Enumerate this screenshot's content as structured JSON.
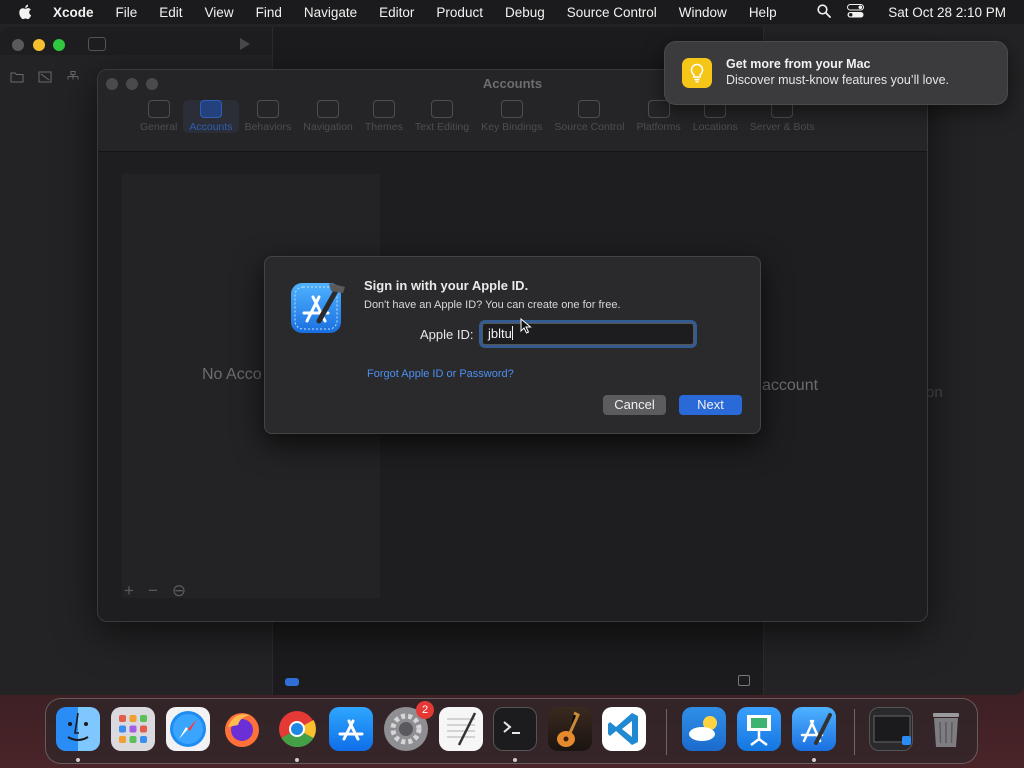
{
  "menubar": {
    "app_name": "Xcode",
    "menus": [
      "File",
      "Edit",
      "View",
      "Find",
      "Navigate",
      "Editor",
      "Product",
      "Debug",
      "Source Control",
      "Window",
      "Help"
    ],
    "clock": "Sat Oct 28  2:10 PM",
    "icons": [
      "apple-logo-icon",
      "search-icon",
      "control-center-icon"
    ]
  },
  "accounts_window": {
    "title": "Accounts",
    "tabs": [
      "General",
      "Accounts",
      "Behaviors",
      "Navigation",
      "Themes",
      "Text Editing",
      "Key Bindings",
      "Source Control",
      "Platforms",
      "Locations",
      "Server & Bots"
    ],
    "active_tab": "Accounts",
    "no_accounts_text": "No Acco",
    "add_account_text": "account",
    "right_fragment": "on",
    "list_controls": [
      "+",
      "−",
      "⊖"
    ]
  },
  "signin": {
    "heading": "Sign in with your Apple ID.",
    "subtext": "Don't have an Apple ID? You can create one for free.",
    "apple_id_label": "Apple ID:",
    "apple_id_value": "jbltu",
    "forgot_link": "Forgot Apple ID or Password?",
    "cancel_label": "Cancel",
    "next_label": "Next"
  },
  "notification": {
    "title": "Get more from your Mac",
    "body": "Discover must-know features you’ll love.",
    "icon": "lightbulb-icon"
  },
  "dock": {
    "apps": [
      "Finder",
      "Launchpad",
      "Safari",
      "Firefox",
      "Chrome",
      "App Store",
      "System Settings",
      "TextEdit",
      "Terminal",
      "GarageBand",
      "Visual Studio Code",
      "Weather",
      "Keynote",
      "Xcode",
      "Window Preview",
      "Trash"
    ],
    "system_settings_badge": "2",
    "colors": {
      "accent": "#2a6ad8",
      "badge": "#e53935"
    }
  }
}
